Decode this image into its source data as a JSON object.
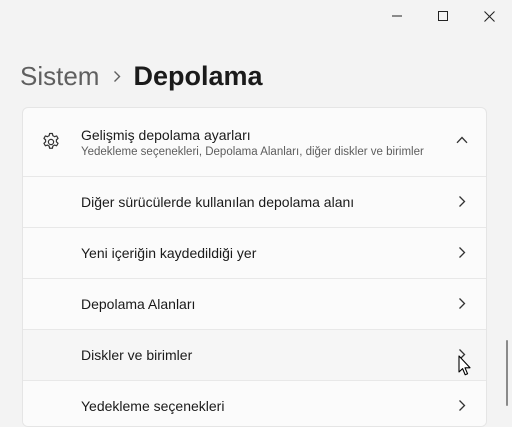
{
  "window": {
    "minimize_icon": "minimize-icon",
    "maximize_icon": "maximize-icon",
    "close_icon": "close-icon"
  },
  "breadcrumb": {
    "parent": "Sistem",
    "current": "Depolama"
  },
  "advanced": {
    "icon": "gear-icon",
    "title": "Gelişmiş depolama ayarları",
    "subtitle": "Yedekleme seçenekleri, Depolama Alanları, diğer diskler ve birimler",
    "expanded": true,
    "items": [
      {
        "label": "Diğer sürücülerde kullanılan depolama alanı"
      },
      {
        "label": "Yeni içeriğin kaydedildiği yer"
      },
      {
        "label": "Depolama Alanları"
      },
      {
        "label": "Diskler ve birimler"
      },
      {
        "label": "Yedekleme seçenekleri"
      }
    ]
  }
}
